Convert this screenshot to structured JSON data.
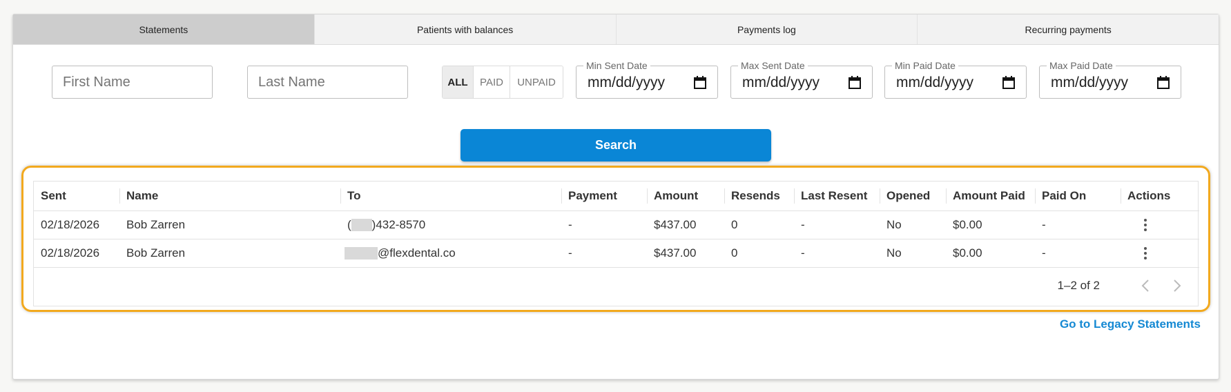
{
  "tabs": [
    {
      "label": "Statements",
      "active": true
    },
    {
      "label": "Patients with balances",
      "active": false
    },
    {
      "label": "Payments log",
      "active": false
    },
    {
      "label": "Recurring payments",
      "active": false
    }
  ],
  "filters": {
    "first_name_placeholder": "First Name",
    "last_name_placeholder": "Last Name",
    "status_options": [
      "ALL",
      "PAID",
      "UNPAID"
    ],
    "status_selected": "ALL",
    "dates": [
      {
        "label": "Min Sent Date",
        "value": "mm/dd/yyyy"
      },
      {
        "label": "Max Sent Date",
        "value": "mm/dd/yyyy"
      },
      {
        "label": "Min Paid Date",
        "value": "mm/dd/yyyy"
      },
      {
        "label": "Max Paid Date",
        "value": "mm/dd/yyyy"
      }
    ]
  },
  "search_label": "Search",
  "table": {
    "columns": [
      "Sent",
      "Name",
      "To",
      "Payment",
      "Amount",
      "Resends",
      "Last Resent",
      "Opened",
      "Amount Paid",
      "Paid On",
      "Actions"
    ],
    "rows": [
      {
        "sent": "02/18/2026",
        "name": "Bob Zarren",
        "to_prefix": "(",
        "to_suffix": ")432-8570",
        "payment": "-",
        "amount": "$437.00",
        "resends": "0",
        "last_resent": "-",
        "opened": "No",
        "amount_paid": "$0.00",
        "paid_on": "-"
      },
      {
        "sent": "02/18/2026",
        "name": "Bob Zarren",
        "to_prefix": "",
        "to_suffix": "@flexdental.co",
        "payment": "-",
        "amount": "$437.00",
        "resends": "0",
        "last_resent": "-",
        "opened": "No",
        "amount_paid": "$0.00",
        "paid_on": "-"
      }
    ]
  },
  "pagination": {
    "text": "1–2 of 2"
  },
  "legacy_link": "Go to Legacy Statements",
  "colors": {
    "primary": "#0a86d6",
    "highlight": "#f2a91e",
    "link": "#1589d3"
  },
  "icons": [
    "calendar-icon",
    "kebab-menu-icon",
    "chevron-left-icon",
    "chevron-right-icon"
  ]
}
